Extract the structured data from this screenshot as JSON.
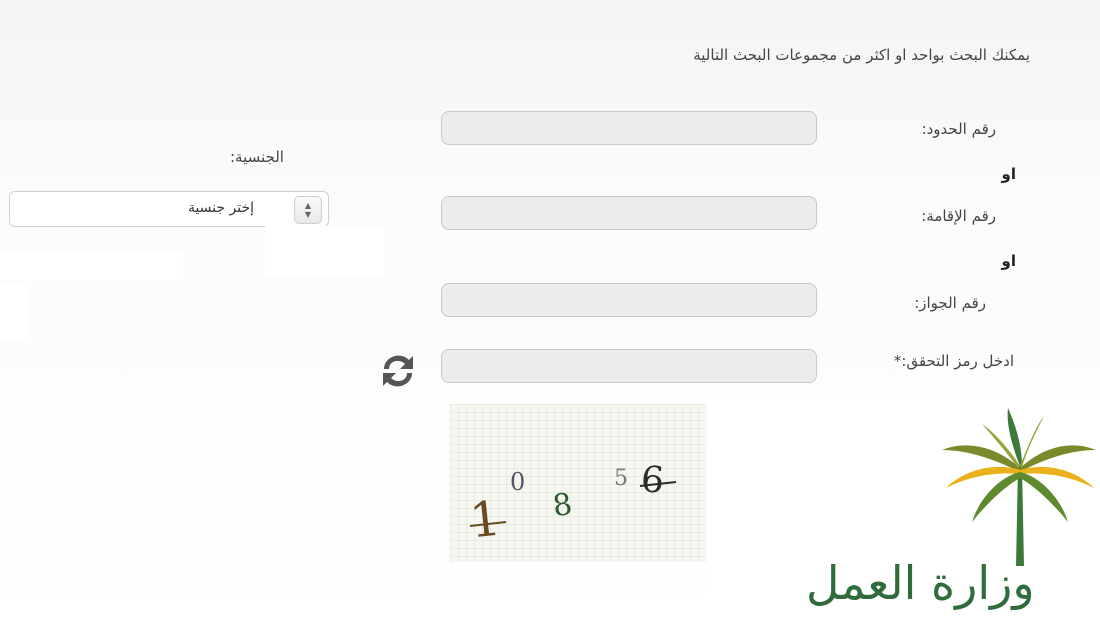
{
  "form": {
    "intro": "يمكنك البحث بواحد او اكثر من مجموعات البحث التالية",
    "or_label": "او",
    "border_number": {
      "label": "رقم الحدود:",
      "value": ""
    },
    "iqama_number": {
      "label": "رقم الإقامة:",
      "value": ""
    },
    "passport_number": {
      "label": "رقم الجواز:",
      "value": ""
    },
    "captcha": {
      "label": "ادخل رمز التحقق:*",
      "value": ""
    },
    "nationality": {
      "label": "الجنسية:",
      "selected": "إختر جنسية"
    }
  },
  "captcha_image": {
    "chars": [
      "1",
      "0",
      "8",
      "5",
      "6"
    ]
  },
  "logo": {
    "text": "وزارة العمل"
  },
  "icons": {
    "refresh": "refresh-icon",
    "select_stepper": "chevron-updown-icon"
  },
  "colors": {
    "logo_green": "#2f6b3b",
    "logo_yellow": "#e9b21d",
    "logo_olive": "#7a8a2a"
  }
}
